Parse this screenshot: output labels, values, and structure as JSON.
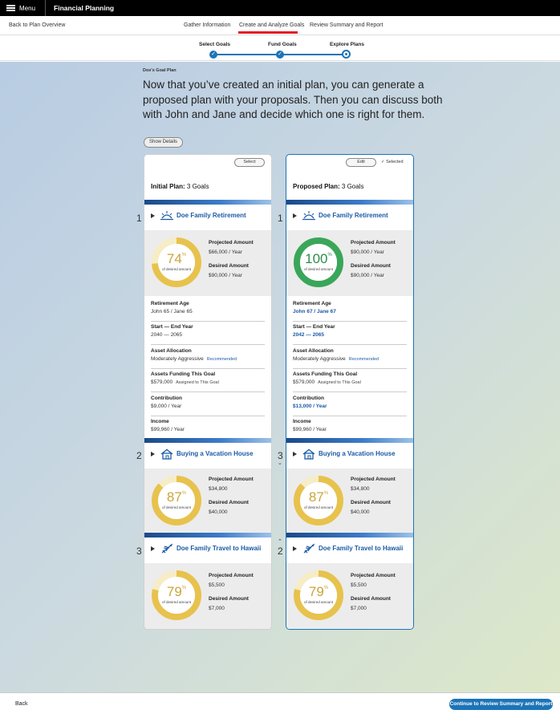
{
  "topbar": {
    "menu_label": "Menu",
    "app_title": "Financial Planning"
  },
  "nav": {
    "back_label": "Back to Plan Overview",
    "tabs": [
      {
        "label": "Gather Information"
      },
      {
        "label": "Create and Analyze Goals"
      },
      {
        "label": "Review Summary and Report"
      }
    ]
  },
  "steps": [
    {
      "label": "Select Goals",
      "status": "complete"
    },
    {
      "label": "Fund Goals",
      "status": "complete"
    },
    {
      "label": "Explore Plans",
      "status": "current"
    }
  ],
  "header": {
    "eyebrow": "Doe's Goal Plan",
    "headline": "Now that you’ve created an initial plan, you can generate a proposed plan with your proposals. Then you can discuss both with John and Jane and decide which one is right for them.",
    "show_details": "Show Details"
  },
  "labels": {
    "projected": "Projected Amount",
    "desired": "Desired Amount",
    "of_desired": "of desired amount",
    "pct_sign": "%"
  },
  "colors": {
    "accent": "#1c74b8",
    "gold": "#e7c24d",
    "green": "#3aa65a",
    "nav_red": "#e31b23"
  },
  "plans": {
    "initial": {
      "button_label": "Select",
      "title_bold": "Initial Plan:",
      "title_rest": " 3 Goals",
      "goals": [
        {
          "rank": "1",
          "name": "Doe Family Retirement",
          "icon": "retirement-sunset-icon",
          "pct": "74",
          "projected": "$66,000 / Year",
          "desired": "$90,000 / Year"
        },
        {
          "rank": "2",
          "name": "Buying a Vacation House",
          "icon": "house-icon",
          "pct": "87",
          "projected": "$34,800",
          "desired": "$40,000"
        },
        {
          "rank": "3",
          "name": "Doe Family Travel to Hawaii",
          "icon": "airplane-icon",
          "pct": "79",
          "projected": "$5,500",
          "desired": "$7,000"
        }
      ],
      "details": [
        {
          "label": "Retirement Age",
          "value": "John 65 / Jane 65"
        },
        {
          "label": "Start — End Year",
          "value": "2040 — 2065"
        },
        {
          "label": "Asset Allocation",
          "value": "Moderately Aggressive",
          "extra": "Recommended"
        },
        {
          "label": "Assets Funding This Goal",
          "value": "$579,000",
          "extra": "Assigned to This Goal"
        },
        {
          "label": "Contribution",
          "value": "$9,000 / Year"
        },
        {
          "label": "Income",
          "value": "$99,960 / Year"
        }
      ]
    },
    "proposed": {
      "button_label": "Edit",
      "selected_label": "Selected",
      "title_bold": "Proposed Plan:",
      "title_rest": " 3 Goals",
      "goals": [
        {
          "rank": "1",
          "name": "Doe Family Retirement",
          "icon": "retirement-sunset-icon",
          "pct": "100",
          "projected": "$90,000 / Year",
          "desired": "$90,000 / Year"
        },
        {
          "rank": "3",
          "name": "Buying a Vacation House",
          "icon": "house-icon",
          "pct": "87",
          "projected": "$34,800",
          "desired": "$40,000"
        },
        {
          "rank": "2",
          "name": "Doe Family Travel to Hawaii",
          "icon": "airplane-icon",
          "pct": "79",
          "projected": "$5,500",
          "desired": "$7,000"
        }
      ],
      "details": [
        {
          "label": "Retirement Age",
          "value": "John 67 / Jane 67"
        },
        {
          "label": "Start — End Year",
          "value": "2042 — 2065"
        },
        {
          "label": "Asset Allocation",
          "value": "Moderately Aggressive",
          "extra": "Recommended"
        },
        {
          "label": "Assets Funding This Goal",
          "value": "$579,000",
          "extra": "Assigned to This Goal"
        },
        {
          "label": "Contribution",
          "value": "$13,000 / Year"
        },
        {
          "label": "Income",
          "value": "$99,960 / Year"
        }
      ]
    }
  },
  "footer": {
    "back_label": "Back",
    "continue_label": "Continue to Review Summary and Report"
  }
}
